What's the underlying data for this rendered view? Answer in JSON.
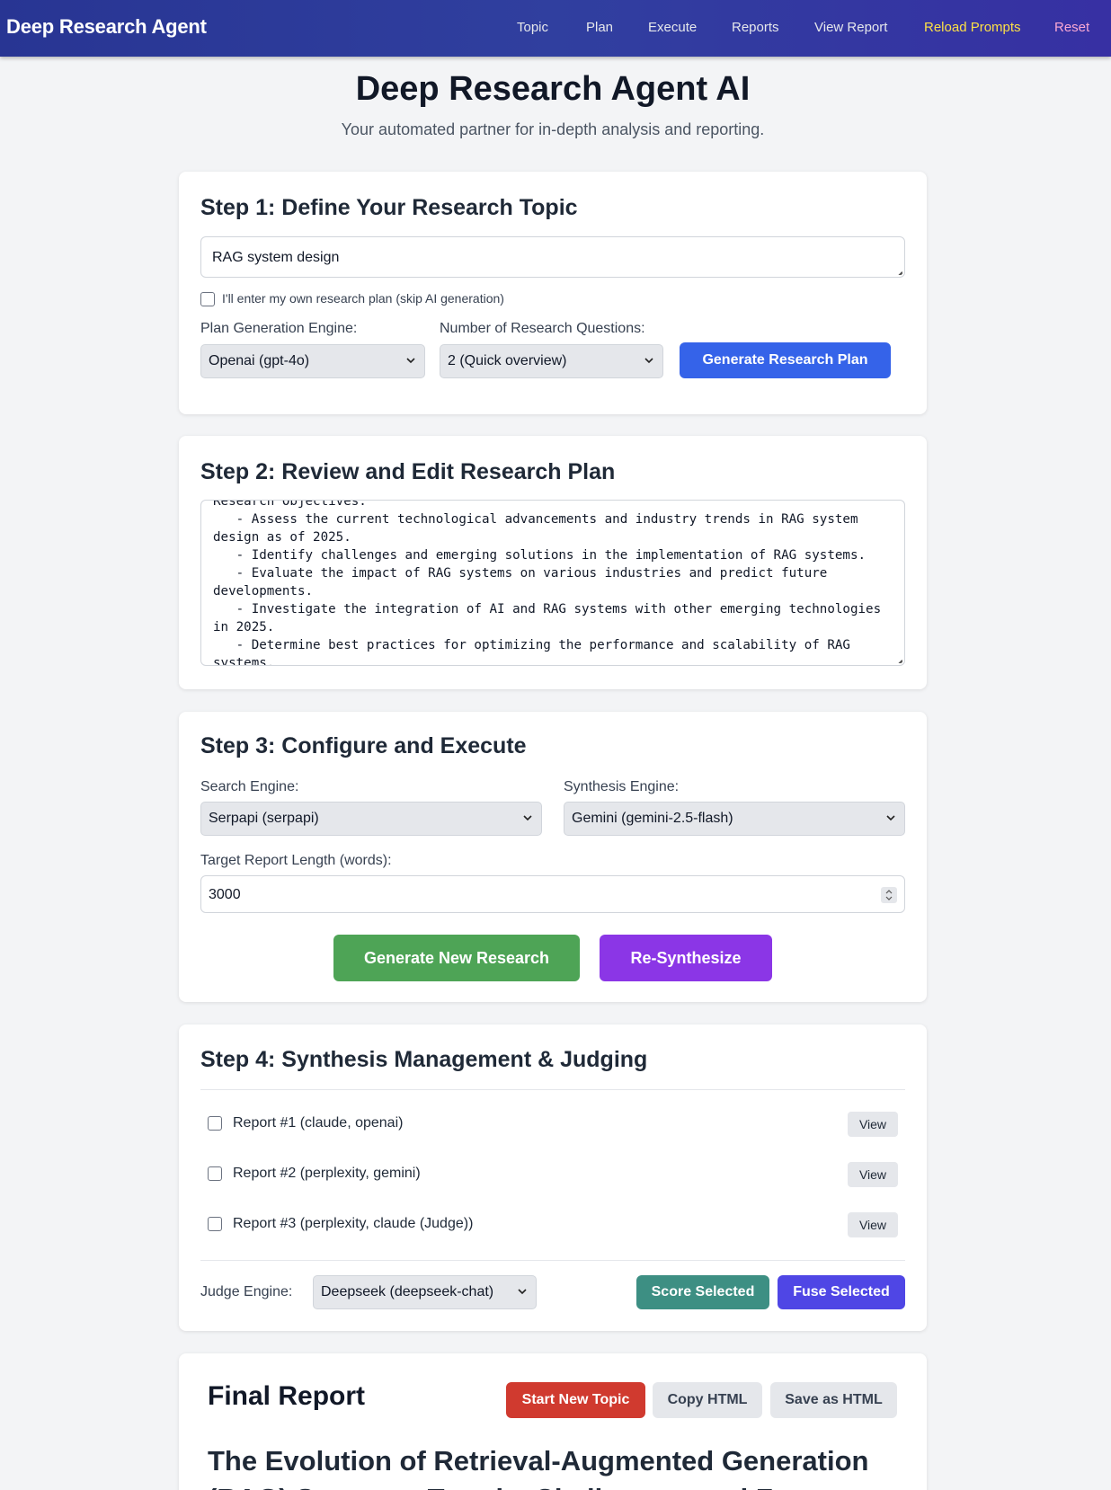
{
  "nav": {
    "brand": "Deep Research Agent",
    "links": [
      "Topic",
      "Plan",
      "Execute",
      "Reports",
      "View Report"
    ],
    "reload_prompts": "Reload Prompts",
    "reset": "Reset"
  },
  "hero": {
    "title": "Deep Research Agent AI",
    "subtitle": "Your automated partner for in-depth analysis and reporting."
  },
  "step1": {
    "title": "Step 1: Define Your Research Topic",
    "topic_value": "RAG system design",
    "own_plan_label": "I'll enter my own research plan (skip AI generation)",
    "plan_engine_label": "Plan Generation Engine:",
    "plan_engine_value": "Openai (gpt-4o)",
    "num_questions_label": "Number of Research Questions:",
    "num_questions_value": "2 (Quick overview)",
    "generate_plan_button": "Generate Research Plan"
  },
  "step2": {
    "title": "Step 2: Review and Edit Research Plan",
    "plan_text": "Research Objectives:\n   - Assess the current technological advancements and industry trends in RAG system design as of 2025.\n   - Identify challenges and emerging solutions in the implementation of RAG systems.\n   - Evaluate the impact of RAG systems on various industries and predict future developments.\n   - Investigate the integration of AI and RAG systems with other emerging technologies in 2025.\n   - Determine best practices for optimizing the performance and scalability of RAG systems."
  },
  "step3": {
    "title": "Step 3: Configure and Execute",
    "search_engine_label": "Search Engine:",
    "search_engine_value": "Serpapi (serpapi)",
    "synthesis_engine_label": "Synthesis Engine:",
    "synthesis_engine_value": "Gemini (gemini-2.5-flash)",
    "target_length_label": "Target Report Length (words):",
    "target_length_value": "3000",
    "generate_button": "Generate New Research",
    "resynthesize_button": "Re-Synthesize"
  },
  "step4": {
    "title": "Step 4: Synthesis Management & Judging",
    "reports": [
      {
        "label": "Report #1 (claude, openai)",
        "view": "View"
      },
      {
        "label": "Report #2 (perplexity, gemini)",
        "view": "View"
      },
      {
        "label": "Report #3 (perplexity, claude (Judge))",
        "view": "View"
      }
    ],
    "judge_label": "Judge Engine:",
    "judge_value": "Deepseek (deepseek-chat)",
    "score_button": "Score Selected",
    "fuse_button": "Fuse Selected"
  },
  "final": {
    "title": "Final Report",
    "start_new_button": "Start New Topic",
    "copy_html_button": "Copy HTML",
    "save_html_button": "Save as HTML",
    "report_heading": "The Evolution of Retrieval-Augmented Generation (RAG) Systems: Trends, Challenges, and Future Directions"
  },
  "colors": {
    "nav_gradient": [
      "#283593",
      "#3730a3"
    ],
    "primary_blue": "#3563e9",
    "green": "#4ea456",
    "purple": "#8b36e6",
    "teal": "#3d8f83",
    "indigo": "#4f46e5",
    "red": "#d03a2f"
  }
}
